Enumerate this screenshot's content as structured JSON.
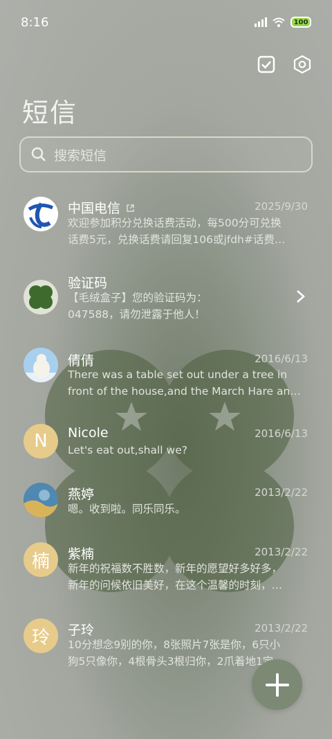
{
  "status_bar": {
    "time": "8:16",
    "battery": "100"
  },
  "header": {
    "title": "短信"
  },
  "search": {
    "placeholder": "搜索短信"
  },
  "messages": [
    {
      "name": "中国电信",
      "date": "2025/9/30",
      "line1": "欢迎参加积分兑换话费活动，每500分可兑换",
      "line2": "话费5元，兑换话费请回复106或jfdh#话费…"
    },
    {
      "name": "验证码",
      "date": "",
      "line1": "【毛绒盒子】您的验证码为：",
      "line2": "047588，请勿泄露于他人！"
    },
    {
      "name": "倩倩",
      "date": "2016/6/13",
      "line1": "There was a table set out under a tree in",
      "line2": "front of the house,and the March Hare an…"
    },
    {
      "name": "Nicole",
      "avatar_letter": "N",
      "date": "2016/6/13",
      "line1": "Let's eat out,shall we?"
    },
    {
      "name": "燕婷",
      "date": "2013/2/22",
      "line1": "嗯。收到啦。同乐同乐。"
    },
    {
      "name": "紫楠",
      "avatar_letter": "楠",
      "date": "2013/2/22",
      "line1": "新年的祝福数不胜数，新年的愿望好多好多，",
      "line2": "新年的问候依旧美好，在这个温馨的时刻，…"
    },
    {
      "name": "子玲",
      "avatar_letter": "玲",
      "date": "2013/2/22",
      "line1": "10分想念9别的你，8张照片7张是你，6只小",
      "line2": "狗5只像你，4根骨头3根归你，2爪着地1定…"
    }
  ],
  "icons": {
    "select": "checkbox-icon",
    "settings": "settings-icon",
    "search": "search-icon",
    "compose": "plus-icon"
  },
  "colors": {
    "accent": "#7c8974",
    "avatar_letter_bg": "#e7cb8a"
  }
}
